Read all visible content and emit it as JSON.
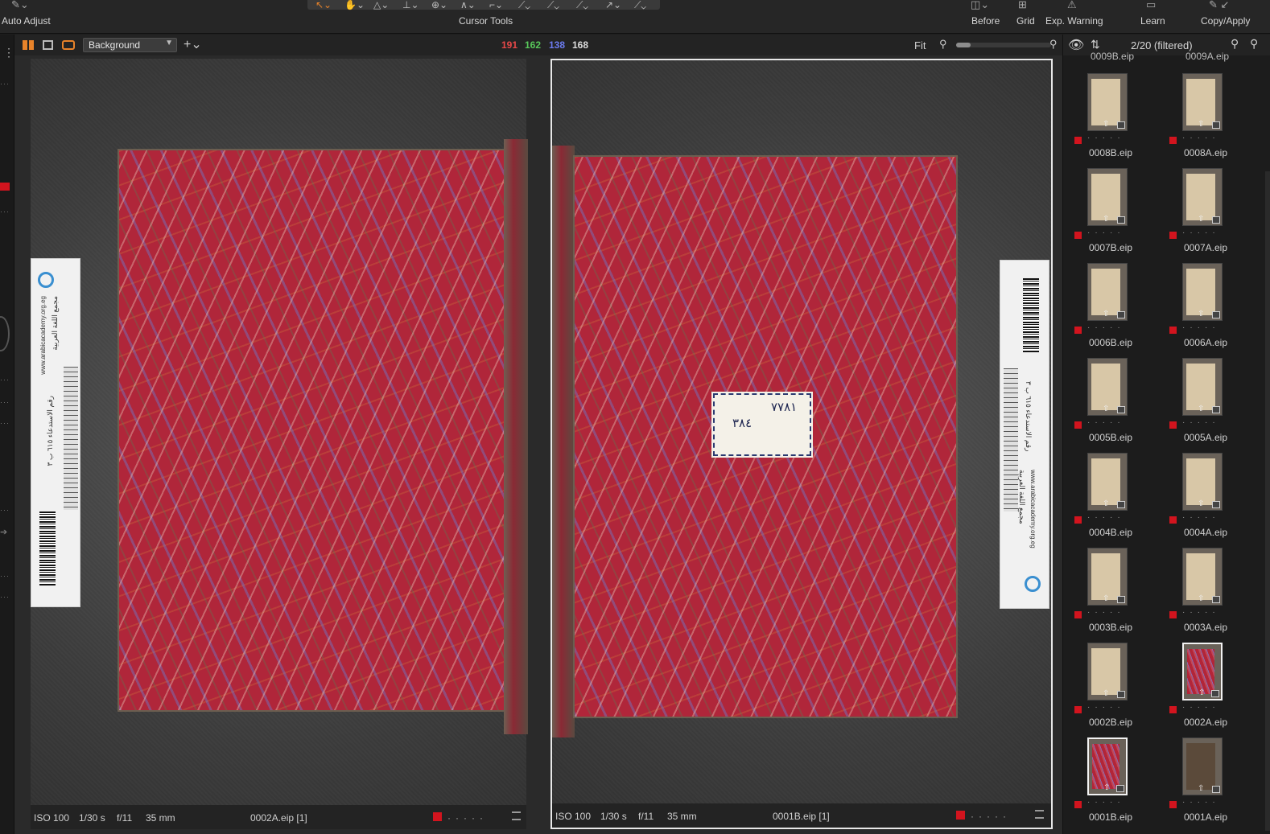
{
  "toolbar": {
    "auto_adjust": "Auto Adjust",
    "cursor_tools": "Cursor Tools",
    "before": "Before",
    "grid": "Grid",
    "exp_warning": "Exp. Warning",
    "learn": "Learn",
    "copy_apply": "Copy/Apply"
  },
  "viewer_bar": {
    "background_select": "Background",
    "rgb": {
      "r": "191",
      "g": "162",
      "b": "138",
      "l": "168"
    },
    "fit": "Fit"
  },
  "browser": {
    "count": "2/20 (filtered)",
    "top_partial": [
      "0009B.eip",
      "0009A.eip"
    ],
    "rows": [
      [
        "0008B.eip",
        "0008A.eip"
      ],
      [
        "0007B.eip",
        "0007A.eip"
      ],
      [
        "0006B.eip",
        "0006A.eip"
      ],
      [
        "0005B.eip",
        "0005A.eip"
      ],
      [
        "0004B.eip",
        "0004A.eip"
      ],
      [
        "0003B.eip",
        "0003A.eip"
      ],
      [
        "0002B.eip",
        "0002A.eip"
      ],
      [
        "0001B.eip",
        "0001A.eip"
      ]
    ]
  },
  "left_image": {
    "iso": "ISO 100",
    "shutter": "1/30 s",
    "aperture": "f/11",
    "focal": "35 mm",
    "filename": "0002A.eip [1]"
  },
  "right_image": {
    "iso": "ISO 100",
    "shutter": "1/30 s",
    "aperture": "f/11",
    "focal": "35 mm",
    "filename": "0001B.eip [1]",
    "label_line1": "٧٧٨١",
    "label_line2": "٣٨٤"
  },
  "ruler": {
    "url": "www.arabicacademy.org.eg",
    "org": "مجمع اللغة العربية",
    "call": "رقم الاستدعاء ٦١٥ ب ٣"
  },
  "colors": {
    "accent_orange": "#e8832a",
    "red_flag": "#d2141e",
    "r": "#e84848",
    "g": "#58c85a",
    "b": "#6c7cf0"
  }
}
